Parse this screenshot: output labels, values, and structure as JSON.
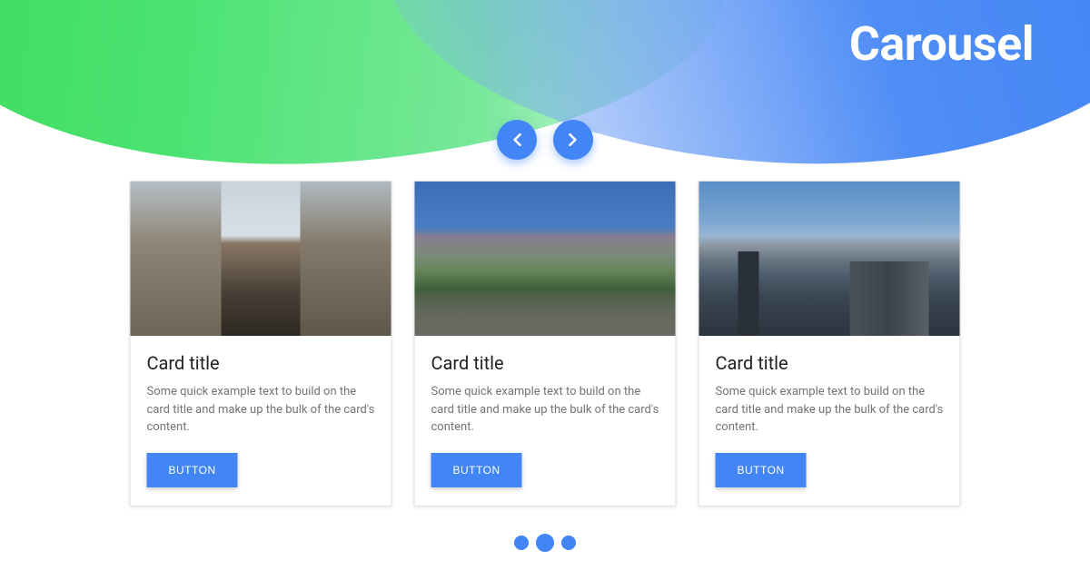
{
  "hero": {
    "title": "Carousel"
  },
  "nav": {
    "prev_icon": "chevron-left",
    "next_icon": "chevron-right"
  },
  "cards": [
    {
      "title": "Card title",
      "text": "Some quick example text to build on the card title and make up the bulk of the card's content.",
      "button": "BUTTON"
    },
    {
      "title": "Card title",
      "text": "Some quick example text to build on the card title and make up the bulk of the card's content.",
      "button": "BUTTON"
    },
    {
      "title": "Card title",
      "text": "Some quick example text to build on the card title and make up the bulk of the card's content.",
      "button": "BUTTON"
    }
  ],
  "pagination": {
    "count": 3,
    "active_index": 1
  },
  "colors": {
    "primary": "#4285f4",
    "green": "#3ddb5a"
  }
}
